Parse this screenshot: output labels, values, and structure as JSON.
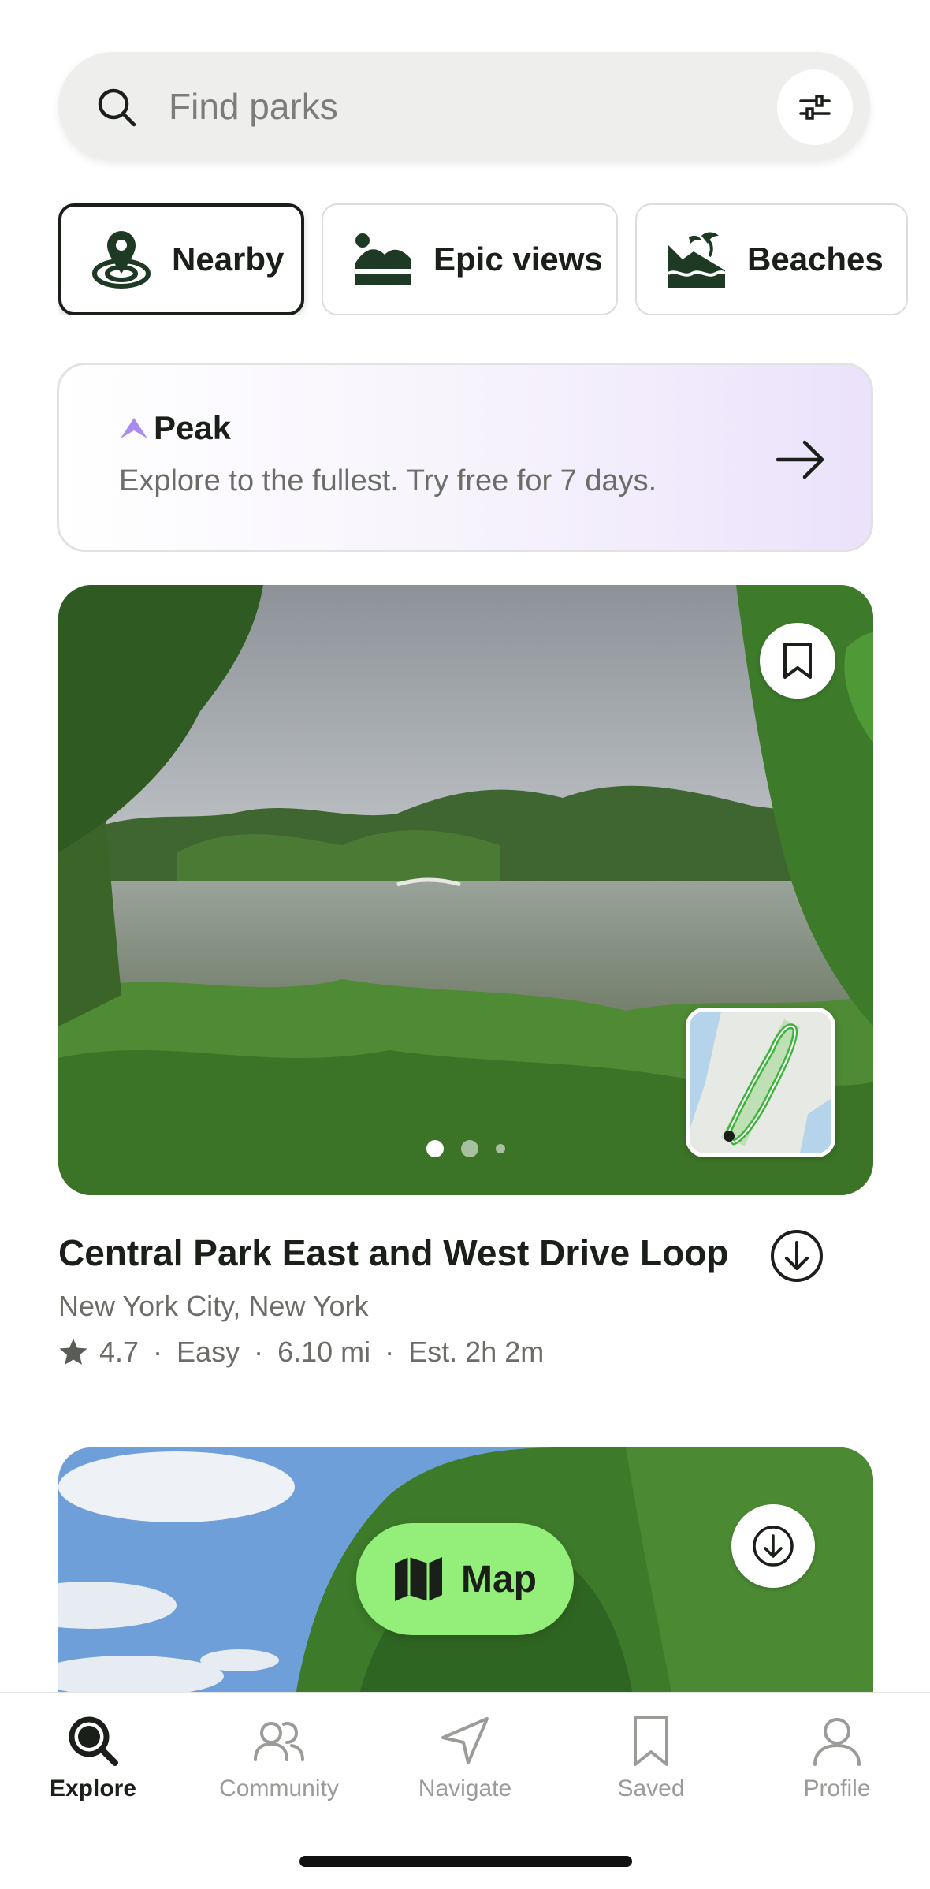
{
  "search": {
    "placeholder": "Find parks",
    "icon": "search-icon",
    "filter_icon": "sliders-icon"
  },
  "categories": [
    {
      "label": "Nearby",
      "icon": "location-pin-icon",
      "active": true
    },
    {
      "label": "Epic views",
      "icon": "mountain-view-icon",
      "active": false
    },
    {
      "label": "Beaches",
      "icon": "beach-icon",
      "active": false
    }
  ],
  "promo": {
    "brand": "Peak",
    "text": "Explore to the fullest. Try free for 7 days.",
    "accent": "#a98cf2"
  },
  "trail": {
    "title": "Central Park East and West Drive Loop",
    "location": "New York City, New York",
    "rating": "4.7",
    "difficulty": "Easy",
    "distance": "6.10 mi",
    "duration": "Est. 2h 2m",
    "separator": "·",
    "photo_count": 3,
    "active_photo_index": 0
  },
  "map_button": {
    "label": "Map",
    "color": "#93ee7a"
  },
  "tabs": [
    {
      "label": "Explore",
      "icon": "explore-search-icon",
      "active": true
    },
    {
      "label": "Community",
      "icon": "community-icon",
      "active": false
    },
    {
      "label": "Navigate",
      "icon": "navigate-icon",
      "active": false
    },
    {
      "label": "Saved",
      "icon": "bookmark-icon",
      "active": false
    },
    {
      "label": "Profile",
      "icon": "profile-icon",
      "active": false
    }
  ]
}
